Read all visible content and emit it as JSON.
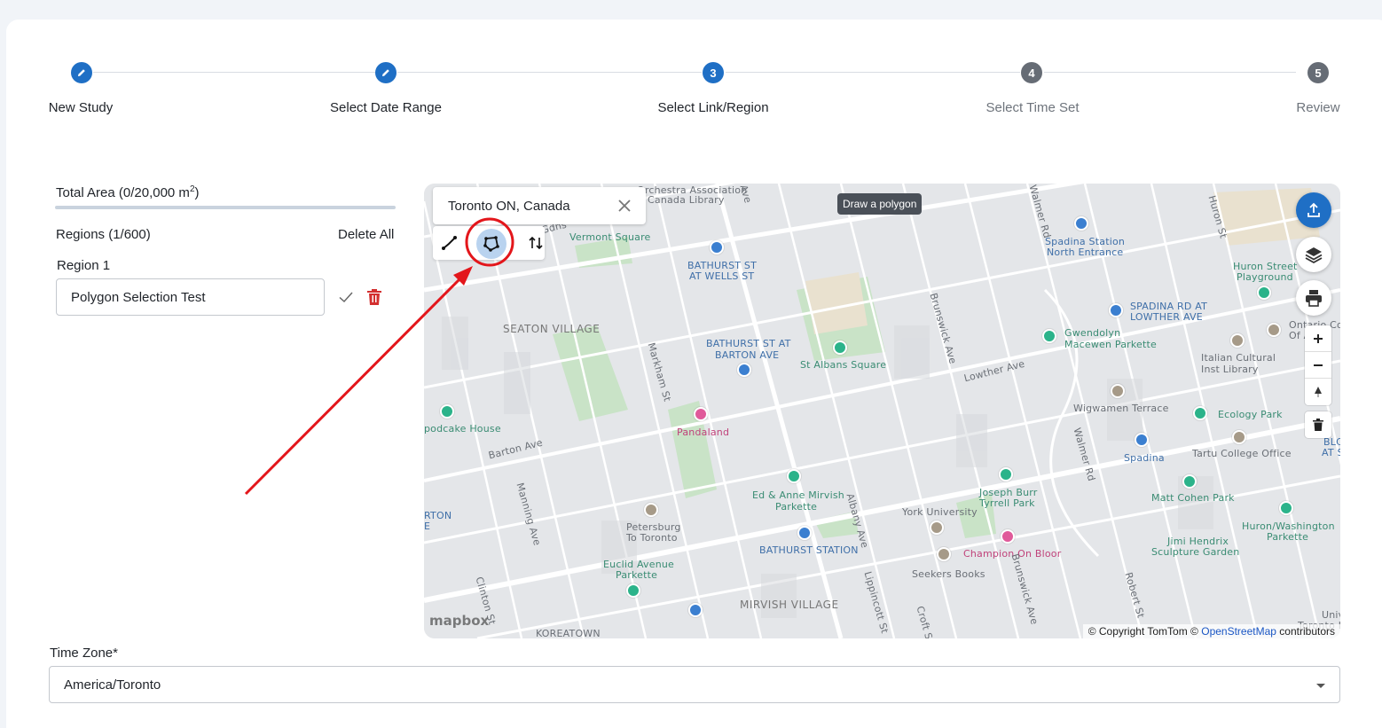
{
  "stepper": {
    "steps": [
      {
        "number": "",
        "label": "New Study",
        "state": "completed",
        "icon": "pencil-icon"
      },
      {
        "number": "",
        "label": "Select Date Range",
        "state": "completed",
        "icon": "pencil-icon"
      },
      {
        "number": "3",
        "label": "Select Link/Region",
        "state": "active"
      },
      {
        "number": "4",
        "label": "Select Time Set",
        "state": "inactive"
      },
      {
        "number": "5",
        "label": "Review",
        "state": "inactive"
      }
    ]
  },
  "regions_panel": {
    "total_area_label": "Total Area (0/20,000 m",
    "total_area_sup": "2",
    "total_area_suffix": ")",
    "regions_count": "Regions (1/600)",
    "delete_all": "Delete All",
    "region_label": "Region 1",
    "region_name_value": "Polygon Selection Test"
  },
  "map": {
    "search_value": "Toronto ON, Canada",
    "tooltip": "Draw a polygon",
    "labels": {
      "orchestra": "Orchestra Association",
      "canada_library": "Canada Library",
      "gdns": "Gdns",
      "vermont_square": "Vermont Square",
      "bathurst_wells": [
        "BATHURST ST",
        "AT WELLS ST"
      ],
      "seaton_village": "SEATON VILLAGE",
      "bathurst_barton": [
        "BATHURST ST AT",
        "BARTON AVE"
      ],
      "st_albans": "St Albans Square",
      "spadina_station_north": [
        "Spadina Station",
        "North Entrance"
      ],
      "huron_playground": [
        "Huron Street",
        "Playground"
      ],
      "spadina_lowther": [
        "SPADINA RD AT",
        "LOWTHER AVE"
      ],
      "ontario_col": [
        "Ontario Col",
        "Of Art"
      ],
      "gwendolyn": [
        "Gwendolyn",
        "Macewen Parkette"
      ],
      "italian_library": [
        "Italian Cultural",
        "Inst Library"
      ],
      "lowther_ave": "Lowther Ave",
      "wigwamen": "Wigwamen Terrace",
      "ecology_park": "Ecology Park",
      "spadina": "Spadina",
      "tartu": "Tartu College Office",
      "blc": [
        "BLC",
        "AT S"
      ],
      "podcake": "podcake House",
      "barton_ave": "Barton Ave",
      "pandaland": "Pandaland",
      "ed_anne": [
        "Ed & Anne Mirvish",
        "Parkette"
      ],
      "joseph_burr": [
        "Joseph Burr",
        "Tyrrell Park"
      ],
      "matt_cohen": "Matt Cohen Park",
      "york_university": "York University",
      "huron_washington": [
        "Huron/Washington",
        "Parkette"
      ],
      "jimi_hendrix": [
        "Jimi Hendrix",
        "Sculpture Garden"
      ],
      "petersburg": [
        "Petersburg",
        "To Toronto"
      ],
      "bathurst_station": "BATHURST STATION",
      "champion": "Champion On Bloor",
      "seekers": "Seekers Books",
      "euclid": [
        "Euclid Avenue",
        "Parkette"
      ],
      "mirvish_village": "MIRVISH VILLAGE",
      "koreatown": "KOREATOWN",
      "rton": [
        "RTON",
        "E"
      ],
      "univ": [
        "Univ",
        "Toronto Lib"
      ],
      "streets": {
        "markham": "Markham St",
        "manning": "Manning Ave",
        "clinton": "Clinton St",
        "brunswick": "Brunswick Ave",
        "brunswick2": "Brunswick Ave",
        "albany": "Albany Ave",
        "walmer": "Walmer Rd",
        "lippincott": "Lippincott St",
        "croft": "Croft St",
        "robert": "Robert St",
        "walmer_top": "Walmer Rd",
        "huron_top": "Huron St",
        "ave_top": "Ave"
      }
    },
    "mapbox_logo": "mapbox",
    "attribution_prefix": "© Copyright TomTom ©",
    "attribution_link": "OpenStreetMap",
    "attribution_suffix": "contributors"
  },
  "time_zone": {
    "label": "Time Zone*",
    "selected": "America/Toronto"
  },
  "colors": {
    "accent": "#1f6fc5",
    "inactive_step": "#666c75",
    "delete": "#d32f2f",
    "annotation": "#e3161b"
  }
}
